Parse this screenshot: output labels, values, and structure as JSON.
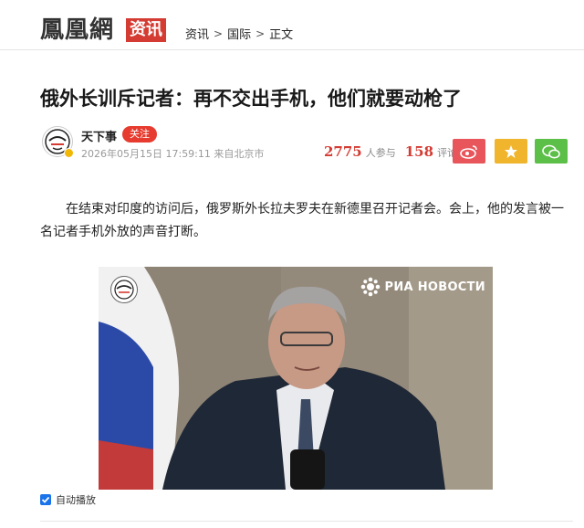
{
  "header": {
    "logo": "鳳凰網",
    "logo_tag": "资讯",
    "breadcrumb": [
      "资讯",
      "国际",
      "正文"
    ],
    "breadcrumb_sep": ">"
  },
  "article": {
    "title": "俄外长训斥记者：再不交出手机，他们就要动枪了",
    "author": "天下事",
    "follow_label": "关注",
    "meta": "2026年05月15日 17:59:11 来自北京市",
    "participants_count": "2775",
    "participants_label": "人参与",
    "comments_count": "158",
    "comments_label": "评论",
    "paragraph": "在结束对印度的访问后，俄罗斯外长拉夫罗夫在新德里召开记者会。会上，他的发言被一名记者手机外放的声音打断。"
  },
  "video": {
    "watermark": "РИА НОВОСТИ",
    "autoplay_label": "自动播放",
    "autoplay_checked": true
  },
  "colors": {
    "brand_red": "#d43c33",
    "weibo": "#e8565c",
    "favorite": "#f0b42d",
    "wechat": "#5cbf47",
    "checkbox": "#1a73e8"
  },
  "icons": {
    "share_weibo": "weibo-icon",
    "share_favorite": "star-icon",
    "share_wechat": "wechat-icon"
  }
}
